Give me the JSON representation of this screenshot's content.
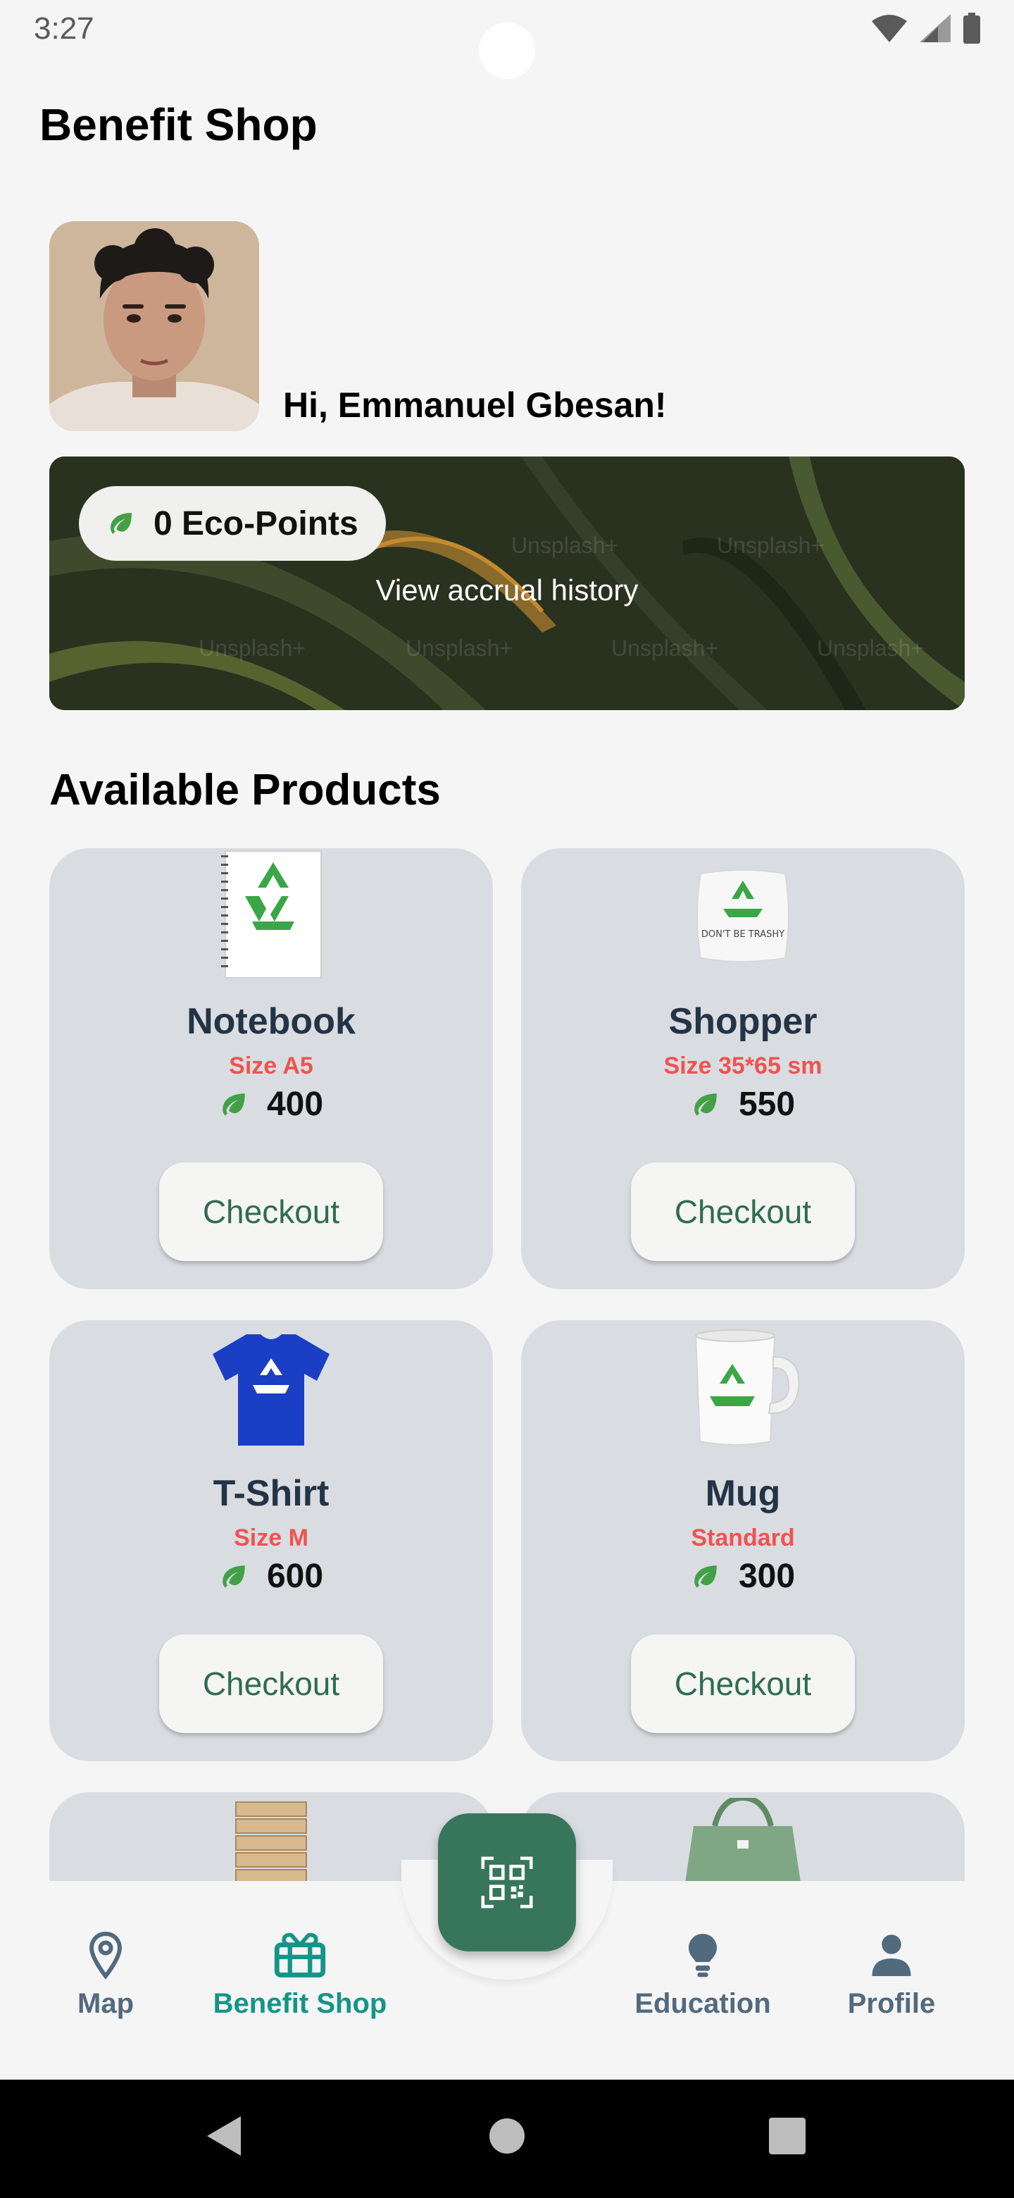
{
  "status_bar": {
    "time": "3:27"
  },
  "header": {
    "title": "Benefit Shop"
  },
  "user": {
    "greeting": "Hi, Emmanuel Gbesan!"
  },
  "eco_banner": {
    "points_label": "0 Eco-Points",
    "history_link": "View accrual history",
    "watermark": "Unsplash+"
  },
  "products_section": {
    "title": "Available Products"
  },
  "products": [
    {
      "name": "Notebook",
      "size": "Size A5",
      "price": "400",
      "checkout_label": "Checkout",
      "icon": "notebook-recycle-image"
    },
    {
      "name": "Shopper",
      "size": "Size 35*65 sm",
      "price": "550",
      "checkout_label": "Checkout",
      "icon": "pillow-shopper-image",
      "image_text": "DON'T BE TRASHY"
    },
    {
      "name": "T-Shirt",
      "size": "Size M",
      "price": "600",
      "checkout_label": "Checkout",
      "icon": "tshirt-recycle-image"
    },
    {
      "name": "Mug",
      "size": "Standard",
      "price": "300",
      "checkout_label": "Checkout",
      "icon": "mug-recycle-image"
    },
    {
      "name": "",
      "size": "",
      "price": "",
      "checkout_label": "",
      "icon": "wooden-blocks-image"
    },
    {
      "name": "",
      "size": "",
      "price": "",
      "checkout_label": "",
      "icon": "green-tote-bag-image"
    }
  ],
  "bottom_nav": {
    "items": [
      {
        "label": "Map",
        "icon": "map-pin-icon"
      },
      {
        "label": "Benefit Shop",
        "icon": "gift-icon",
        "active": true
      },
      {
        "label": "Education",
        "icon": "lightbulb-icon"
      },
      {
        "label": "Profile",
        "icon": "person-icon"
      }
    ],
    "fab_icon": "qr-code-scan-icon"
  },
  "colors": {
    "accent_green": "#37765a",
    "active_nav": "#139588",
    "inactive_nav": "#526a7e",
    "size_red": "#ef5350",
    "card_bg": "#d9dde2",
    "leaf_green": "#43a047"
  }
}
